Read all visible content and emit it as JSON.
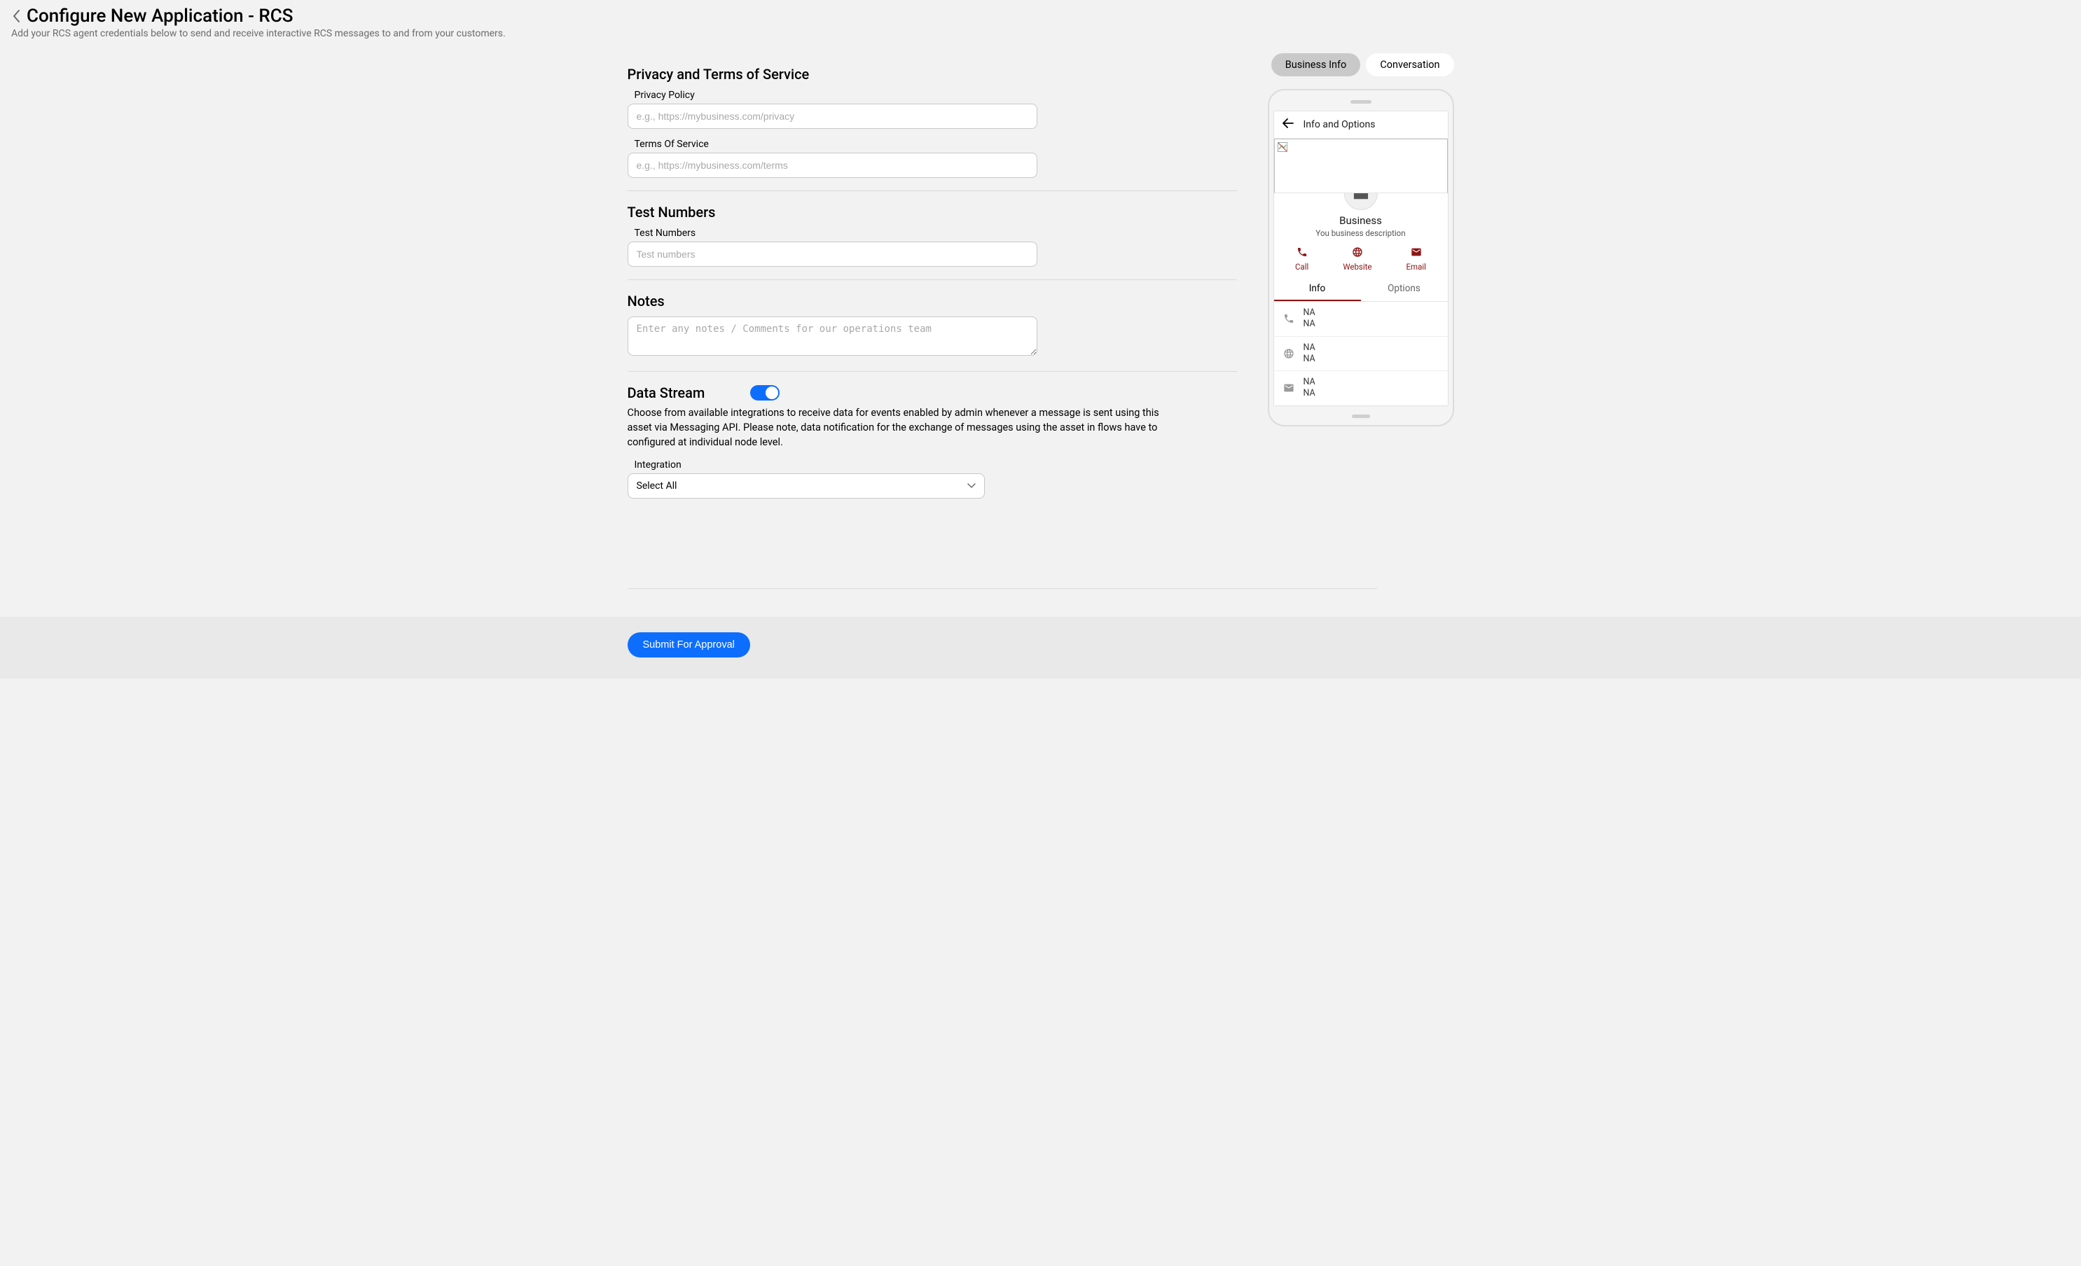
{
  "header": {
    "title": "Configure New Application - RCS",
    "subtitle": "Add your RCS agent credentials below to send and receive interactive RCS messages to and from your customers."
  },
  "sections": {
    "privacy": {
      "title": "Privacy and Terms of Service",
      "privacyLabel": "Privacy Policy",
      "privacyPlaceholder": "e.g., https://mybusiness.com/privacy",
      "termsLabel": "Terms Of Service",
      "termsPlaceholder": "e.g., https://mybusiness.com/terms"
    },
    "testNumbers": {
      "title": "Test Numbers",
      "label": "Test Numbers",
      "placeholder": "Test numbers"
    },
    "notes": {
      "title": "Notes",
      "placeholder": "Enter any notes / Comments for our operations team"
    },
    "dataStream": {
      "title": "Data Stream",
      "desc": "Choose from available integrations to receive data for events enabled by admin whenever a message is sent using this asset via Messaging API. Please note, data notification for the exchange of messages using the asset in flows have to configured at individual node level.",
      "integrationLabel": "Integration",
      "integrationSelected": "Select All"
    }
  },
  "footer": {
    "submitLabel": "Submit For Approval"
  },
  "preview": {
    "tabs": {
      "businessInfo": "Business Info",
      "conversation": "Conversation"
    },
    "infoOptionsHeader": "Info and Options",
    "businessName": "Business",
    "businessDesc": "You business description",
    "actions": {
      "call": "Call",
      "website": "Website",
      "email": "Email"
    },
    "subTabs": {
      "info": "Info",
      "options": "Options"
    },
    "rows": {
      "phone": {
        "line1": "NA",
        "line2": "NA"
      },
      "web": {
        "line1": "NA",
        "line2": "NA"
      },
      "email": {
        "line1": "NA",
        "line2": "NA"
      }
    }
  }
}
